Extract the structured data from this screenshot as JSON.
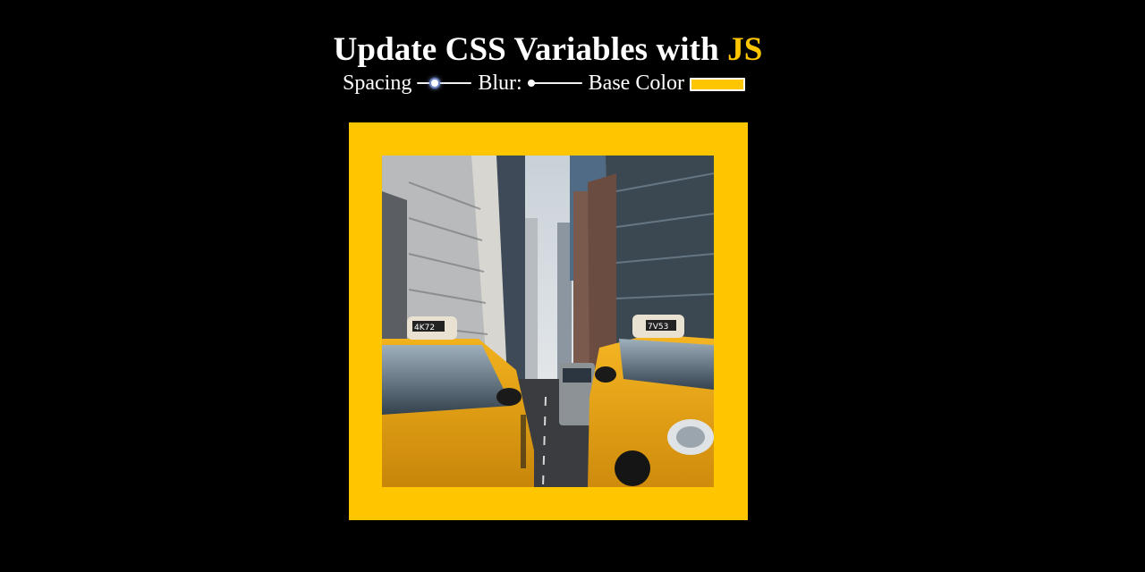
{
  "header": {
    "title_main": "Update CSS Variables with",
    "title_accent": "JS"
  },
  "controls": {
    "spacing": {
      "label": "Spacing",
      "value_fraction": 0.3
    },
    "blur": {
      "label": "Blur:",
      "value_fraction": 0.0
    },
    "base_color": {
      "label": "Base Color",
      "value": "#ffc600"
    }
  },
  "image": {
    "subject": "yellow-taxis-city-street",
    "cab_numbers": [
      "4K72",
      "7V53"
    ]
  },
  "colors": {
    "background": "#000000",
    "text": "#ffffff",
    "accent": "#ffc600"
  }
}
